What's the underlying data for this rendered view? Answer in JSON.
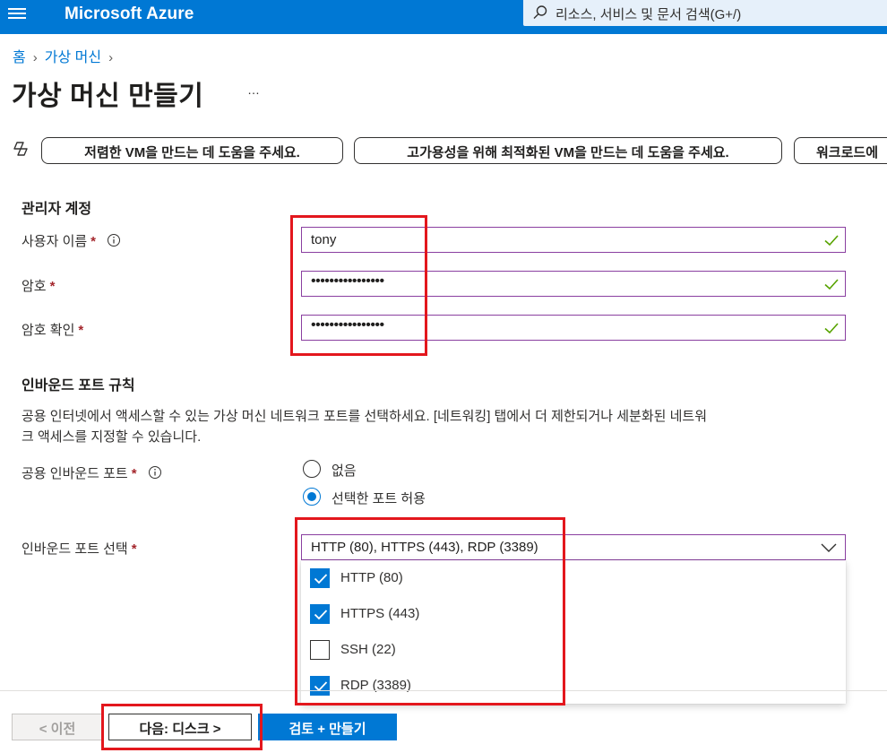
{
  "topbar": {
    "brand": "Microsoft Azure",
    "search_placeholder": "리소스, 서비스 및 문서 검색(G+/)"
  },
  "breadcrumb": {
    "items": [
      "홈",
      "가상 머신"
    ]
  },
  "page": {
    "title": "가상 머신 만들기",
    "more": "…"
  },
  "suggestions": [
    "저렴한 VM을 만드는 데 도움을 주세요.",
    "고가용성을 위해 최적화된 VM을 만드는 데 도움을 주세요.",
    "워크로드에"
  ],
  "admin": {
    "section_title": "관리자 계정",
    "username_label": "사용자 이름",
    "username_value": "tony",
    "password_label": "암호",
    "password_value": "••••••••••••••••",
    "confirm_label": "암호 확인",
    "confirm_value": "••••••••••••••••",
    "required_mark": "*"
  },
  "inbound": {
    "section_title": "인바운드 포트 규칙",
    "description_line1": "공용 인터넷에서 액세스할 수 있는 가상 머신 네트워크 포트를 선택하세요. [네트워킹] 탭에서 더 제한되거나 세분화된 네트워",
    "description_line2": "크 액세스를 지정할 수 있습니다.",
    "public_ports_label": "공용 인바운드 포트",
    "radio_options": [
      "없음",
      "선택한 포트 허용"
    ],
    "selected_radio": "선택한 포트 허용",
    "select_label": "인바운드 포트 선택",
    "select_value": "HTTP (80), HTTPS (443), RDP (3389)",
    "port_options": [
      {
        "label": "HTTP (80)",
        "checked": true
      },
      {
        "label": "HTTPS (443)",
        "checked": true
      },
      {
        "label": "SSH (22)",
        "checked": false
      },
      {
        "label": "RDP (3389)",
        "checked": true
      }
    ]
  },
  "footer": {
    "prev": "< 이전",
    "next": "다음: 디스크 >",
    "review": "검토 + 만들기"
  },
  "colors": {
    "azure_blue": "#0078d4",
    "highlight_red": "#e3171d",
    "valid_green": "#57a300",
    "input_border": "#8a3fa0"
  },
  "icons": [
    "hamburger-icon",
    "search-icon",
    "copilot-icon",
    "info-icon",
    "check-icon",
    "chevron-down-icon",
    "checkbox-check-icon"
  ]
}
